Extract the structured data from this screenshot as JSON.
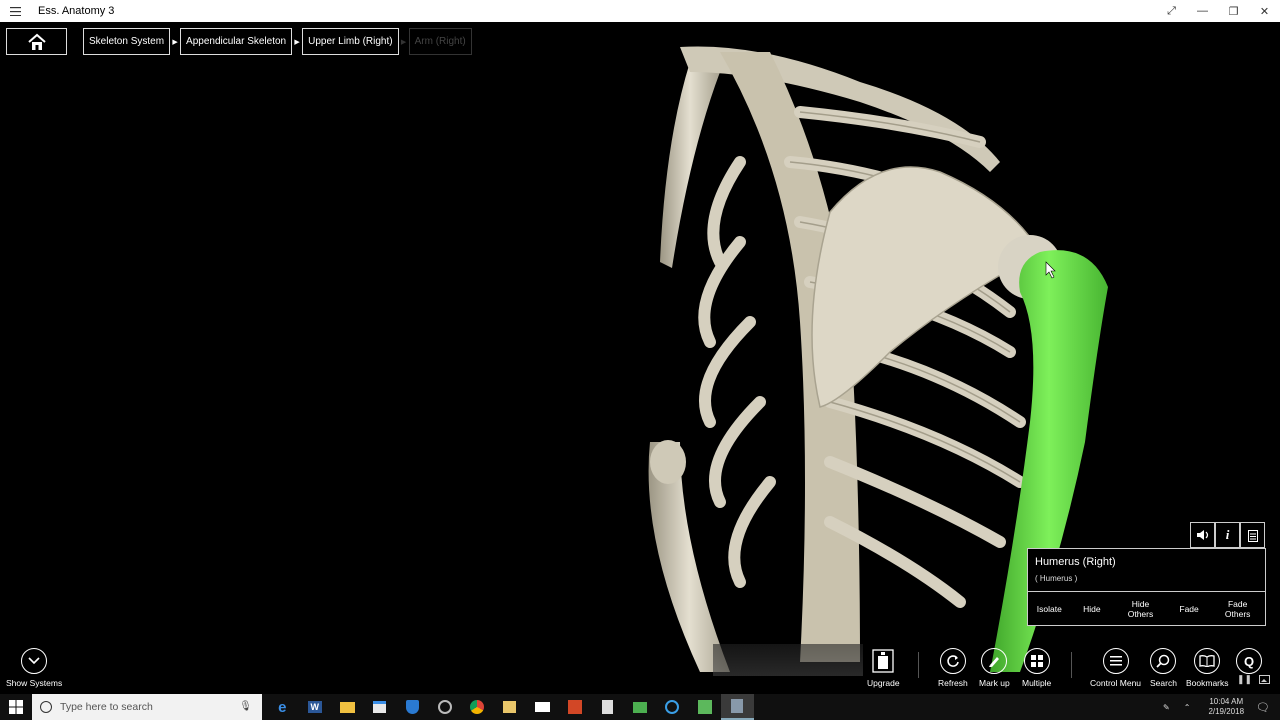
{
  "window": {
    "title": "Ess. Anatomy 3"
  },
  "breadcrumb": {
    "items": [
      {
        "label": "Skeleton System",
        "enabled": true
      },
      {
        "label": "Appendicular Skeleton",
        "enabled": true
      },
      {
        "label": "Upper Limb (Right)",
        "enabled": true
      },
      {
        "label": "Arm (Right)",
        "enabled": false
      }
    ]
  },
  "selection": {
    "name": "Humerus (Right)",
    "subtitle": "( Humerus )",
    "actions": [
      "Isolate",
      "Hide",
      "Hide Others",
      "Fade",
      "Fade Others"
    ],
    "highlight_color": "#6fe04a"
  },
  "toolbar": {
    "show_systems": "Show Systems",
    "upgrade": "Upgrade",
    "refresh": "Refresh",
    "markup": "Mark up",
    "multiple": "Multiple",
    "control_menu": "Control Menu",
    "search": "Search",
    "bookmarks": "Bookmarks",
    "quiz_glyph": "Q"
  },
  "taskbar": {
    "search_placeholder": "Type here to search",
    "time": "10:04 AM",
    "date": "2/19/2018",
    "apps": [
      "edge-icon",
      "word-icon",
      "file-explorer-icon",
      "store-icon",
      "defender-icon",
      "media-icon",
      "chrome-icon",
      "video-icon",
      "mail-icon",
      "powerpoint-icon",
      "calculator-icon",
      "messaging-icon",
      "skype-icon",
      "camtasia-icon",
      "anatomy-app-icon"
    ]
  },
  "colors": {
    "bone": "#d9d3c3",
    "background": "#000000",
    "accent_border": "#cccccc"
  }
}
